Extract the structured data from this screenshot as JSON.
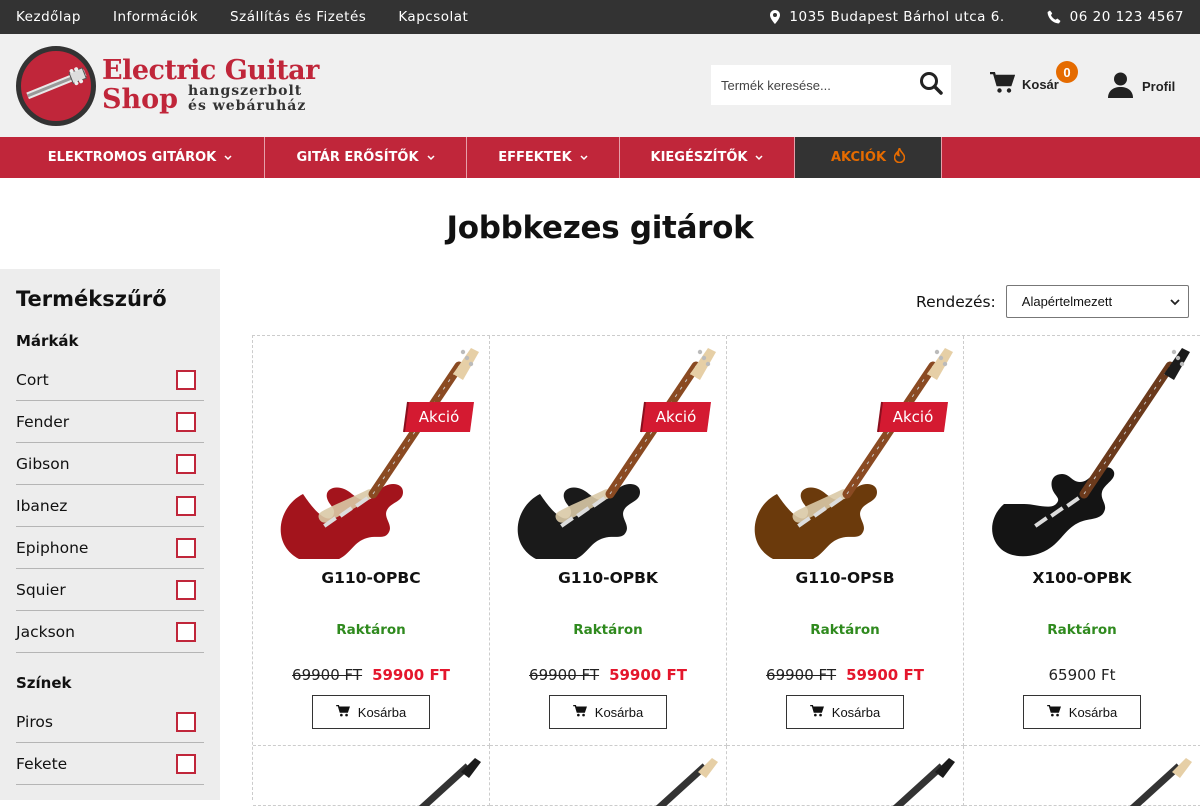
{
  "topbar": {
    "links": [
      "Kezdőlap",
      "Információk",
      "Szállítás és Fizetés",
      "Kapcsolat"
    ],
    "address": "1035 Budapest Bárhol utca 6.",
    "phone": "06 20 123 4567"
  },
  "header": {
    "logo_line1": "Electric Guitar",
    "logo_line2": "Shop",
    "logo_sub1": "hangszerbolt",
    "logo_sub2": "és webáruház",
    "search_placeholder": "Termék keresése...",
    "cart_label": "Kosár",
    "cart_count": "0",
    "profile_label": "Profil"
  },
  "nav": {
    "items": [
      "ELEKTROMOS GITÁROK",
      "GITÁR ERŐSÍTŐK",
      "EFFEKTEK",
      "KIEGÉSZÍTŐK"
    ],
    "sale": "AKCIÓK"
  },
  "page": {
    "title": "Jobbkezes gitárok"
  },
  "sidebar": {
    "title": "Termékszűrő",
    "brands_title": "Márkák",
    "brands": [
      "Cort",
      "Fender",
      "Gibson",
      "Ibanez",
      "Epiphone",
      "Squier",
      "Jackson"
    ],
    "colors_title": "Színek",
    "colors": [
      "Piros",
      "Fekete"
    ]
  },
  "sort": {
    "label": "Rendezés:",
    "selected": "Alapértelmezett"
  },
  "products": [
    {
      "name": "G110-OPBC",
      "stock": "Raktáron",
      "old_price": "69900 FT",
      "price": "59900 FT",
      "sale_label": "Akció",
      "button": "Kosárba",
      "body_color": "#a3141c"
    },
    {
      "name": "G110-OPBK",
      "stock": "Raktáron",
      "old_price": "69900 FT",
      "price": "59900 FT",
      "sale_label": "Akció",
      "button": "Kosárba",
      "body_color": "#1a1a1a"
    },
    {
      "name": "G110-OPSB",
      "stock": "Raktáron",
      "old_price": "69900 FT",
      "price": "59900 FT",
      "sale_label": "Akció",
      "button": "Kosárba",
      "body_color": "#6b3a0c"
    },
    {
      "name": "X100-OPBK",
      "stock": "Raktáron",
      "old_price": "",
      "price": "65900 Ft",
      "sale_label": "",
      "button": "Kosárba",
      "body_color": "#141414"
    }
  ],
  "colors": {
    "brand": "#c0263a",
    "dark": "#333333",
    "accent": "#e56b00",
    "stock": "#2f8a1e",
    "sale_price": "#e4162c"
  }
}
